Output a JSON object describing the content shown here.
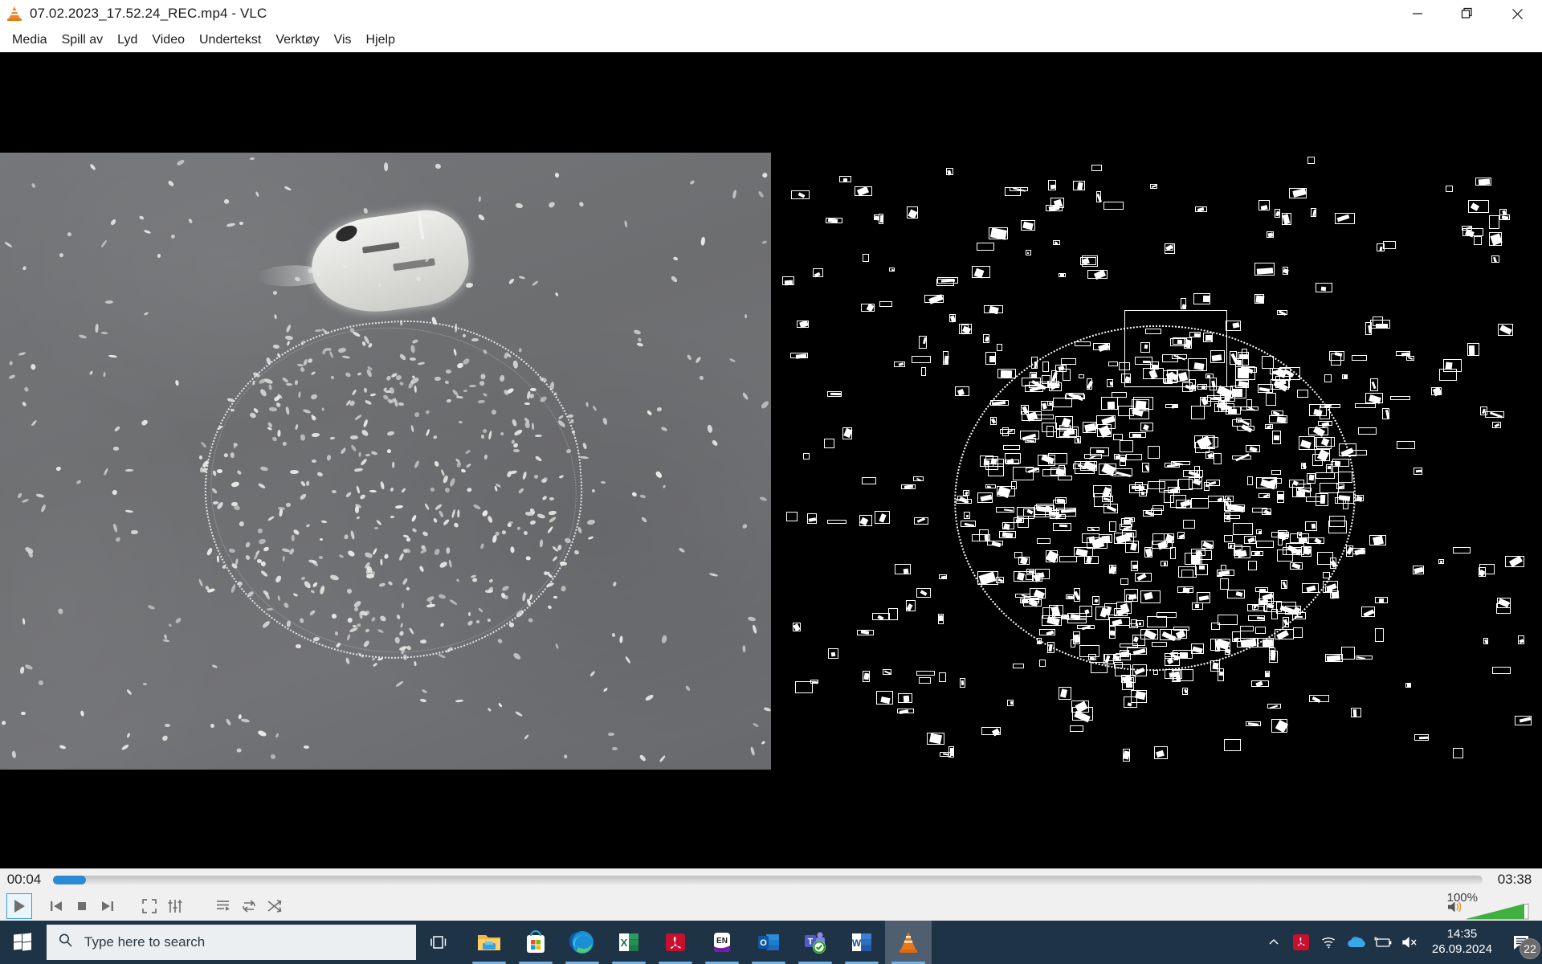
{
  "window": {
    "title": "07.02.2023_17.52.24_REC.mp4 - VLC",
    "app_icon": "vlc-cone-icon",
    "controls": {
      "minimize": "minimize-icon",
      "restore": "restore-icon",
      "close": "close-icon"
    }
  },
  "menubar": {
    "items": [
      {
        "label": "Media"
      },
      {
        "label": "Spill av"
      },
      {
        "label": "Lyd"
      },
      {
        "label": "Video"
      },
      {
        "label": "Undertekst"
      },
      {
        "label": "Verktøy"
      },
      {
        "label": "Vis"
      },
      {
        "label": "Hjelp"
      }
    ]
  },
  "video": {
    "left_panel_description": "grayscale aerial thermal footage of fishing vessel with purse seine net ring and seabirds",
    "right_panel_description": "binary threshold detection view with white bounding boxes around detected seabirds"
  },
  "player": {
    "time_elapsed": "00:04",
    "time_total": "03:38",
    "seek_percent": 2.3,
    "seek_fill_color": "#2a8ad4",
    "volume_label": "100%",
    "volume_percent": 100,
    "volume_color": "#3fb03f",
    "buttons": {
      "play": "play-icon",
      "previous": "previous-track-icon",
      "stop": "stop-icon",
      "next": "next-track-icon",
      "fullscreen": "fullscreen-icon",
      "extended_settings": "equalizer-icon",
      "playlist": "playlist-icon",
      "loop": "loop-icon",
      "shuffle": "shuffle-icon",
      "mute": "speaker-icon"
    }
  },
  "taskbar": {
    "start": "windows-start-icon",
    "search": {
      "placeholder": "Type here to search",
      "icon": "search-icon"
    },
    "task_view": "task-view-icon",
    "apps": [
      {
        "name": "file-explorer",
        "active": false,
        "running": true
      },
      {
        "name": "microsoft-store",
        "active": false,
        "running": true
      },
      {
        "name": "microsoft-edge",
        "active": false,
        "running": true
      },
      {
        "name": "microsoft-excel",
        "active": false,
        "running": true
      },
      {
        "name": "adobe-acrobat",
        "active": false,
        "running": true
      },
      {
        "name": "onenote-en",
        "active": false,
        "running": true
      },
      {
        "name": "microsoft-outlook",
        "active": false,
        "running": true
      },
      {
        "name": "microsoft-teams",
        "active": false,
        "running": true
      },
      {
        "name": "microsoft-word",
        "active": false,
        "running": true
      },
      {
        "name": "vlc-media-player",
        "active": true,
        "running": true
      }
    ],
    "tray": [
      {
        "name": "show-hidden-icons-chevron"
      },
      {
        "name": "adobe-acrobat-tray-icon"
      },
      {
        "name": "wifi-icon"
      },
      {
        "name": "onedrive-icon"
      },
      {
        "name": "battery-charging-icon"
      },
      {
        "name": "speaker-muted-icon"
      }
    ],
    "clock": {
      "time": "14:35",
      "date": "26.09.2024"
    },
    "notifications": {
      "count": "22",
      "icon": "action-center-icon"
    }
  },
  "colors": {
    "titlebar_bg": "#ffffff",
    "taskbar_bg": "#1f3347",
    "control_bg": "#f0f0f0",
    "accent_blue": "#2a8ad4",
    "vlc_orange": "#ec8a2b"
  }
}
